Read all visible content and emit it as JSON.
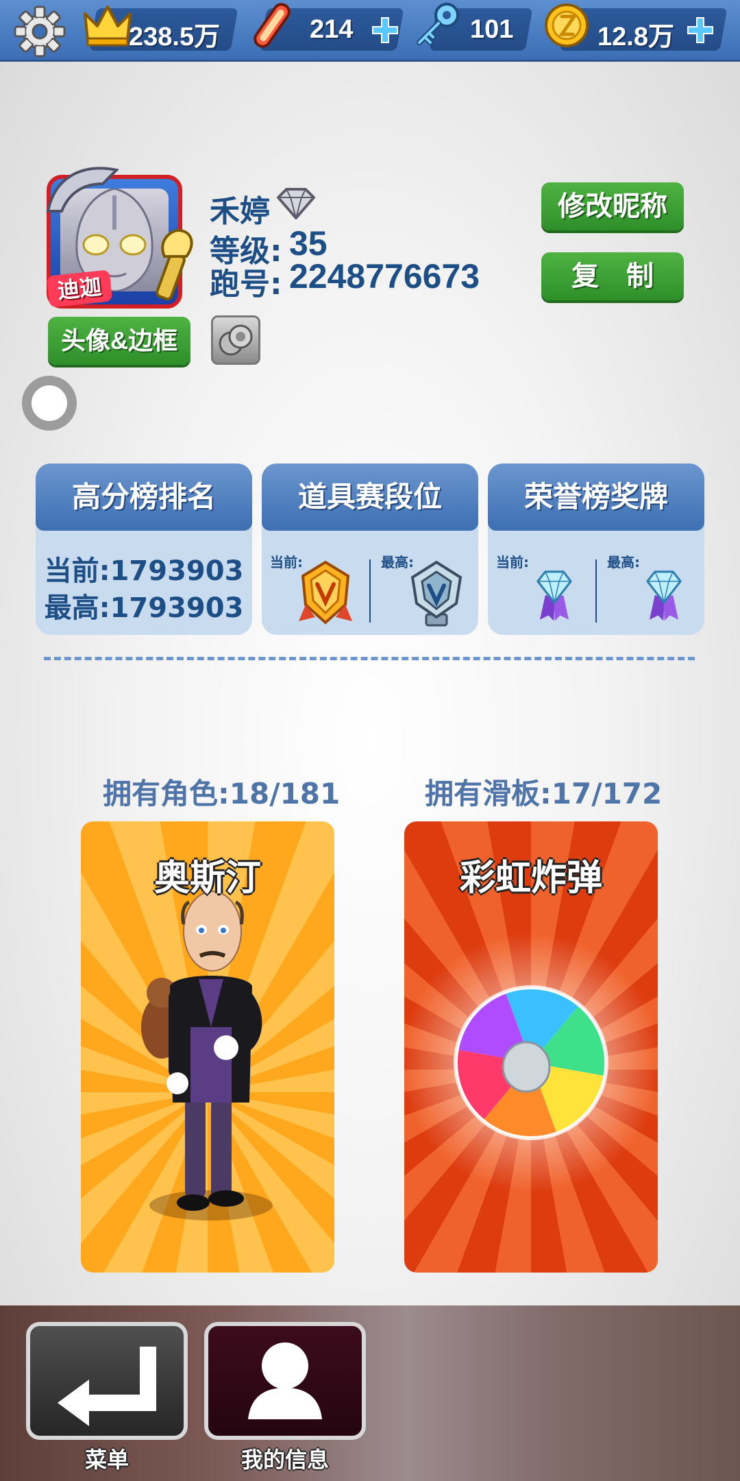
{
  "topbar": {
    "crown_value": "238.5万",
    "board_value": "214",
    "key_value": "101",
    "coin_value": "12.8万"
  },
  "profile": {
    "nickname": "禾婷",
    "level_label": "等级:",
    "level_value": "35",
    "run_label": "跑号:",
    "run_value": "2248776673",
    "avatar_tag": "迪迦",
    "avatar_button": "头像&边框",
    "rename_button": "修改昵称",
    "copy_button": "复　制"
  },
  "panels": {
    "highscore": {
      "title": "高分榜排名",
      "current": "当前:1793903",
      "best": "最高:1793903"
    },
    "item_rank": {
      "title": "道具赛段位",
      "current_label": "当前:",
      "best_label": "最高:"
    },
    "honor": {
      "title": "荣誉榜奖牌",
      "current_label": "当前:",
      "best_label": "最高:"
    }
  },
  "collection": {
    "characters_label": "拥有角色:18/181",
    "boards_label": "拥有滑板:17/172",
    "character_name": "奥斯汀",
    "board_name": "彩虹炸弹"
  },
  "nav": {
    "menu_label": "菜单",
    "myinfo_label": "我的信息"
  },
  "colors": {
    "topbar": "#3c6eb6",
    "green_button": "#3aa034",
    "panel_bg": "#c9dbef",
    "text_blue": "#1d4f86",
    "character_card": "#ffb433",
    "board_card": "#e0451a"
  }
}
